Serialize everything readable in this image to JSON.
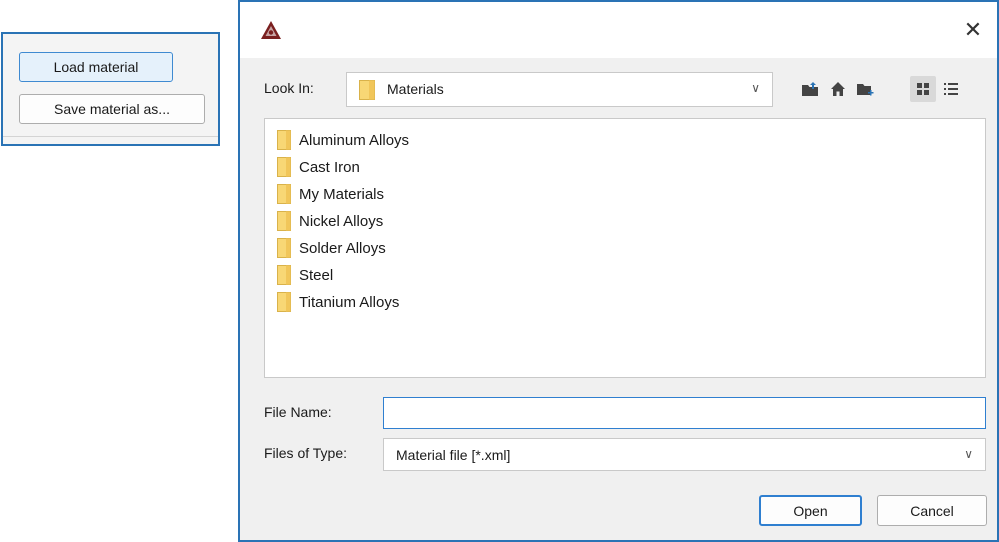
{
  "snippet": {
    "load_label": "Load material",
    "save_label": "Save material as..."
  },
  "dialog": {
    "close_glyph": "✕",
    "look_in_label": "Look In:",
    "look_in_value": "Materials",
    "toolbar_icons": [
      "up-folder-icon",
      "home-icon",
      "new-folder-icon",
      "list-view-icon",
      "details-view-icon"
    ],
    "items": [
      "Aluminum Alloys",
      "Cast Iron",
      "My Materials",
      "Nickel Alloys",
      "Solder Alloys",
      "Steel",
      "Titanium Alloys"
    ],
    "file_name_label": "File Name:",
    "file_name_value": "",
    "files_of_type_label": "Files of Type:",
    "files_of_type_value": "Material file [*.xml]",
    "open_label": "Open",
    "cancel_label": "Cancel"
  },
  "colors": {
    "accent_border": "#2a73b5",
    "folder_fill": "#f8d775",
    "app_icon": "#7a1f1f"
  }
}
